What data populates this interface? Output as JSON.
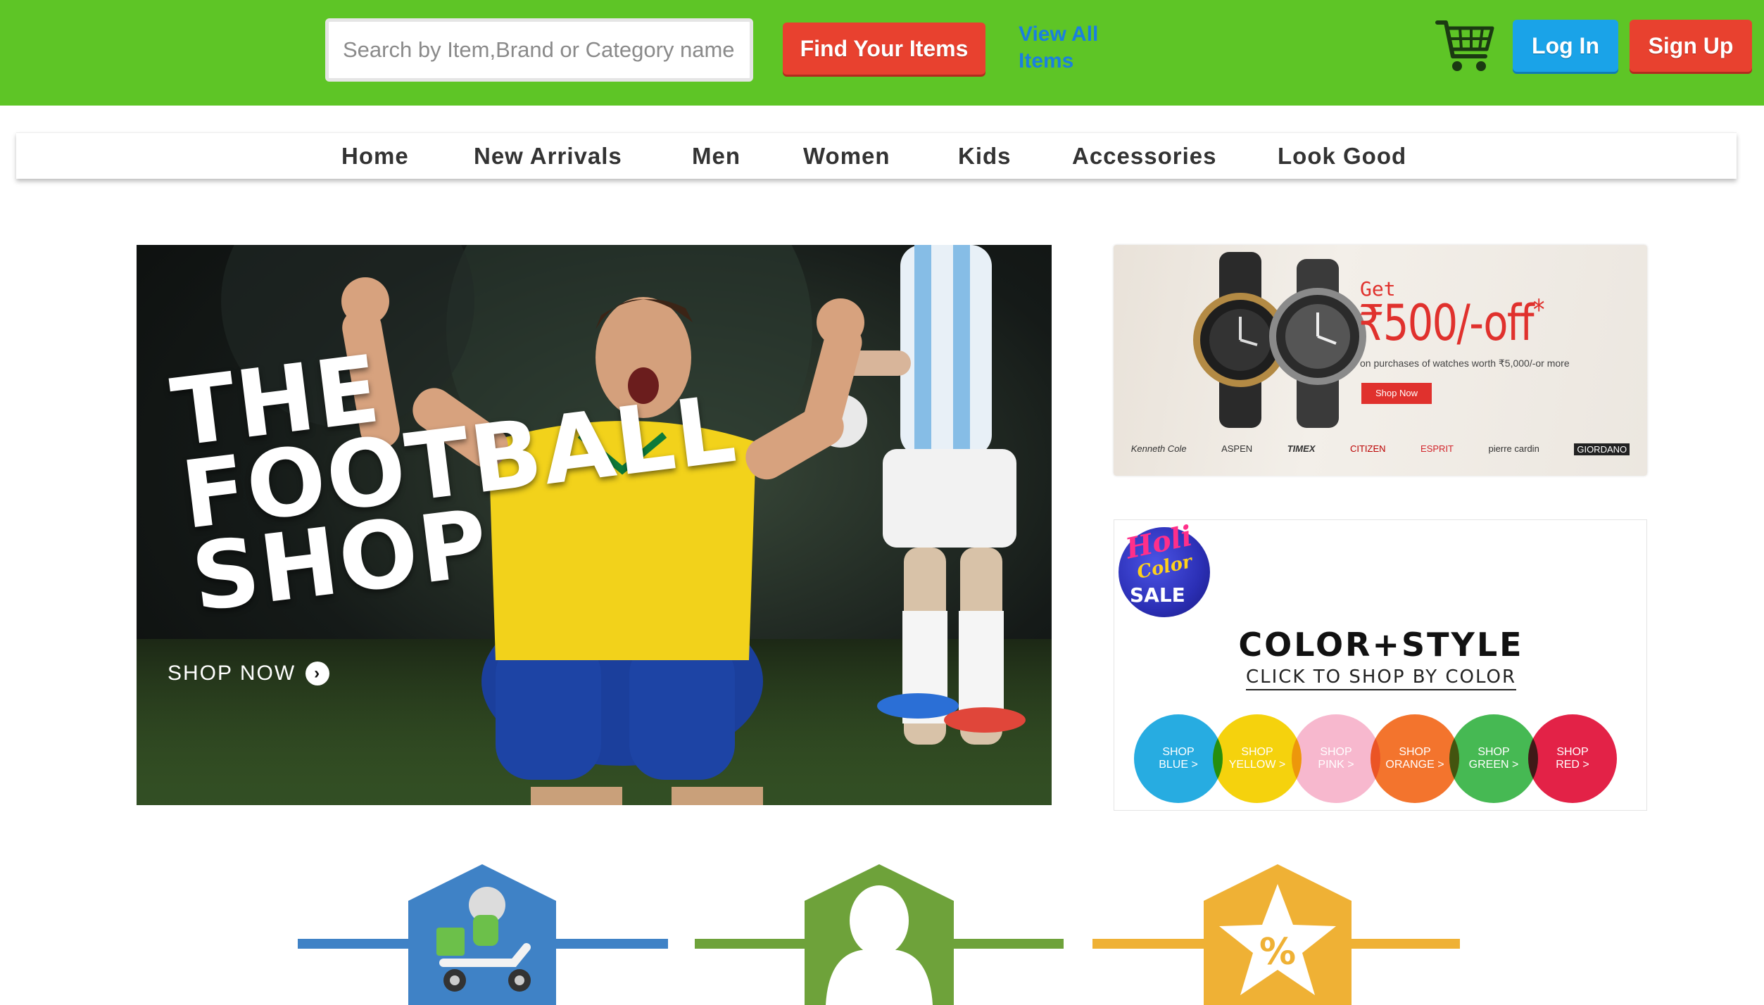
{
  "header": {
    "search_placeholder": "Search by Item,Brand or Category name",
    "find_button": "Find Your Items",
    "view_all": "View All Items",
    "login": "Log In",
    "signup": "Sign Up",
    "colors": {
      "bar": "#5ec526",
      "find": "#e8412f",
      "login": "#1aa3e8",
      "signup": "#e8412f",
      "link": "#1a7fe0"
    }
  },
  "nav": {
    "items": [
      "Home",
      "New Arrivals",
      "Men",
      "Women",
      "Kids",
      "Accessories",
      "Look Good"
    ]
  },
  "hero": {
    "line1": "THE",
    "line2": "FOOTBALL",
    "line3": "SHOP",
    "cta": "SHOP NOW"
  },
  "watch_promo": {
    "get": "Get",
    "offer": "₹500/-off",
    "star": "*",
    "subtext": "on purchases of watches worth ₹5,000/-or more",
    "cta": "Shop Now",
    "brands": [
      "Kenneth Cole",
      "ASPEN",
      "TIMEX",
      "CITIZEN",
      "ESPRIT",
      "pierre cardin",
      "GIORDANO"
    ]
  },
  "color_promo": {
    "badge_line1": "Holi",
    "badge_line2": "Color",
    "badge_line3": "SALE",
    "title": "COLOR+STYLE",
    "subtitle": "CLICK TO SHOP BY COLOR",
    "circles": [
      {
        "line1": "SHOP",
        "line2": "BLUE >",
        "color": "#1ba8e0"
      },
      {
        "line1": "SHOP",
        "line2": "YELLOW >",
        "color": "#f5d000"
      },
      {
        "line1": "SHOP",
        "line2": "PINK >",
        "color": "#f7b4cc"
      },
      {
        "line1": "SHOP",
        "line2": "ORANGE >",
        "color": "#f36c21"
      },
      {
        "line1": "SHOP",
        "line2": "GREEN >",
        "color": "#3cb54a"
      },
      {
        "line1": "SHOP",
        "line2": "RED >",
        "color": "#e2163d"
      }
    ]
  },
  "features": [
    {
      "icon": "delivery-scooter-icon",
      "color": "#3f82c6"
    },
    {
      "icon": "user-icon",
      "color": "#6ea23a"
    },
    {
      "icon": "discount-star-icon",
      "color": "#efb135"
    }
  ]
}
